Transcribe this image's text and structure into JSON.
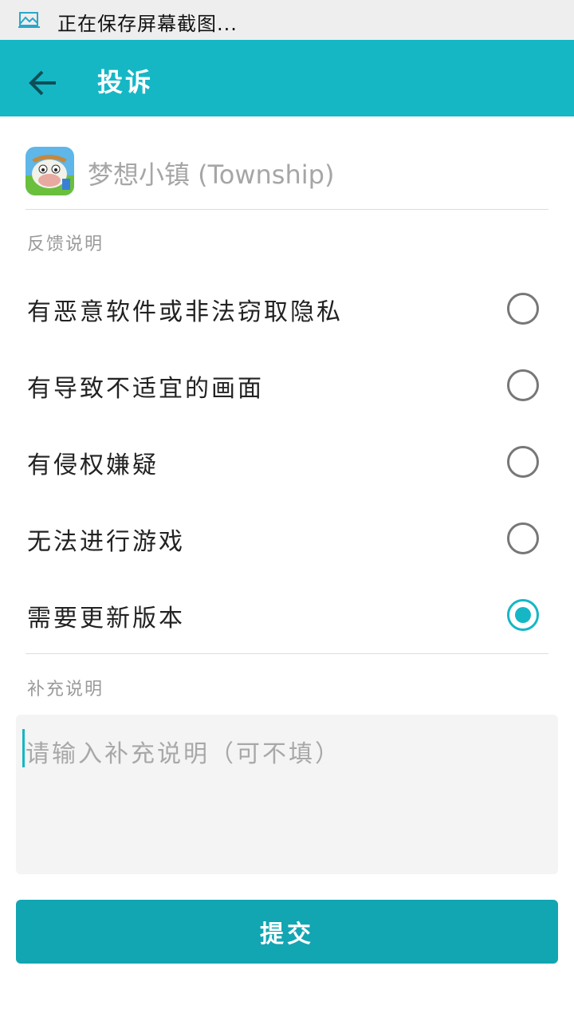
{
  "status_bar": {
    "notification_icon": "screenshot-icon",
    "text": "正在保存屏幕截图..."
  },
  "app_bar": {
    "back_icon": "arrow-left-icon",
    "title": "投诉"
  },
  "app": {
    "icon": "township-app-icon",
    "name": "梦想小镇 (Township)"
  },
  "feedback": {
    "section_label": "反馈说明",
    "options": [
      {
        "label": "有恶意软件或非法窃取隐私",
        "selected": false
      },
      {
        "label": "有导致不适宜的画面",
        "selected": false
      },
      {
        "label": "有侵权嫌疑",
        "selected": false
      },
      {
        "label": "无法进行游戏",
        "selected": false
      },
      {
        "label": "需要更新版本",
        "selected": true
      }
    ]
  },
  "supplement": {
    "section_label": "补充说明",
    "placeholder": "请输入补充说明（可不填）",
    "value": ""
  },
  "submit_label": "提交",
  "colors": {
    "accent": "#15b7c5",
    "button": "#12a5b2",
    "status_bar": "#eeeeee"
  }
}
